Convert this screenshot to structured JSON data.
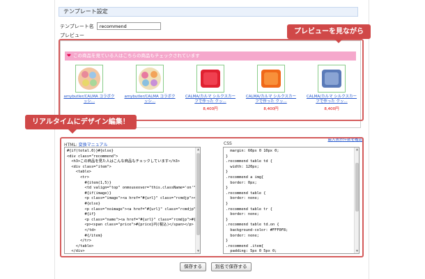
{
  "section_title": "テンプレート設定",
  "template_name": {
    "label": "テンプレート名",
    "value": "recommend"
  },
  "preview_label": "プレビュー",
  "banner_text": "この商品を見ている人はこちらの商品もチェックされています",
  "products": [
    {
      "name": "amybutler/CALMA コラボクッシ...",
      "price": ""
    },
    {
      "name": "amybutler/CALMA コラボクッシ...",
      "price": ""
    },
    {
      "name": "CALMA/カルマ シルクスカーフで作った クッ...",
      "price": "8,400円"
    },
    {
      "name": "CALMA/カルマ シルクスカーフで作った クッ...",
      "price": "8,400円"
    },
    {
      "name": "CALMA/カルマ シルクスカーフで作った クッ...",
      "price": "8,400円"
    }
  ],
  "html_label": "HTML:",
  "html_manual_link": "変換マニュアル",
  "css_label": "CSS",
  "reference_link": "最大表示件数を確認",
  "html_code": "#{if(total.0)}#{else}\n<div class=\"recommend\">\n  <h3>この商品を見た人はこんな商品もチェックしています</h3>\n  <div class=\"item\">\n    <table>\n      <tr>\n        #{item(1,5)}\n        <td valign=\"top\" onmouseover=\"this.className='on'\" onm\n        #{if(image)}\n        <p class=\"image\"><a href=\"#{url}\" class=\"rcmdjp\"><img s\n        #{else}\n        <p class=\"noimage\"><a href=\"#{url}\" class=\"rcmdjp\"><im\n        #{if}\n        <p class=\"name\"><a href=\"#{url}\" class=\"rcmdjp\">#{nam\n        <p><span class=\"price\">#{price}円(税込)</span></p>\n        </td>\n        #{/item}\n      </tr>\n    </table>\n  </div>\n</div>",
  "css_code": "  margin: 60px 0 10px 0;\n}\n.recommend table td {\n  width: 120px;\n}\n.recommend a img{\n  border: 0px;\n}\n.recommend table {\n  border: none;\n}\n.recommend table tr {\n  border: none;\n}\n.recommend table td.on {\n  background-color: #FFF0F8;\n  border: none;\n}\n.recommend .item{\n  padding: 5px 0 5px 0;\n  text-align: left;\n}",
  "buttons": {
    "save": "保存する",
    "save_as": "別名で保存する"
  },
  "callouts": {
    "preview": "プレビューを見ながら",
    "edit": "リアルタイムにデザイン編集！"
  },
  "colors": {
    "callout_red": "#d04848",
    "banner_pink": "#f5a8cc",
    "link_blue": "#2255cc",
    "price_red": "#e00000"
  }
}
